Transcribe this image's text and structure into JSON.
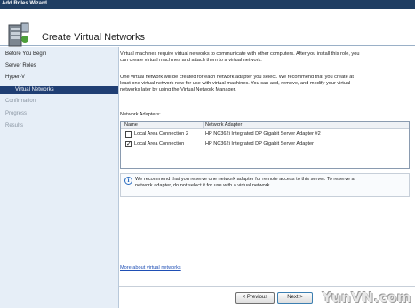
{
  "window": {
    "title": "Add Roles Wizard"
  },
  "header": {
    "heading": "Create Virtual Networks",
    "icon": "server-icon"
  },
  "nav": {
    "items": [
      {
        "label": "Before You Begin",
        "state": "normal"
      },
      {
        "label": "Server Roles",
        "state": "normal"
      },
      {
        "label": "Hyper-V",
        "state": "normal"
      },
      {
        "label": "Virtual Networks",
        "state": "active"
      },
      {
        "label": "Confirmation",
        "state": "disabled"
      },
      {
        "label": "Progress",
        "state": "disabled"
      },
      {
        "label": "Results",
        "state": "disabled"
      }
    ]
  },
  "content": {
    "para1_line1": "Virtual machines require virtual networks to communicate with other computers. After you install this role, you",
    "para1_line2": "can create virtual machines and attach them to a virtual network.",
    "para2_line1": "One virtual network will be created for each network adapter you select. We recommend that you create at",
    "para2_line2": "least one virtual network now for use with virtual machines. You can add, remove, and modify your virtual",
    "para2_line3": "networks later by using the Virtual Network Manager.",
    "adapters_label": "Network Adapters:",
    "table": {
      "columns": [
        "Name",
        "Network Adapter"
      ],
      "rows": [
        {
          "name": "Local Area Connection 2",
          "adapter": "HP NC362i Integrated DP Gigabit Server Adapter #2",
          "checked": false
        },
        {
          "name": "Local Area Connection",
          "adapter": "HP NC362i Integrated DP Gigabit Server Adapter",
          "checked": true
        }
      ]
    },
    "info_line1": "We recommend that you reserve one network adapter for remote access to this server. To reserve a",
    "info_line2": "network adapter, do not select it for use with a virtual network.",
    "more_link": "More about virtual networks"
  },
  "footer": {
    "previous": "< Previous",
    "next": "Next >"
  },
  "watermark": "YunVN.com",
  "colors": {
    "title_bar": "#1f3e63",
    "nav_bg": "#e6eef7",
    "nav_active": "#1f3e73",
    "link": "#1f4fb5"
  }
}
